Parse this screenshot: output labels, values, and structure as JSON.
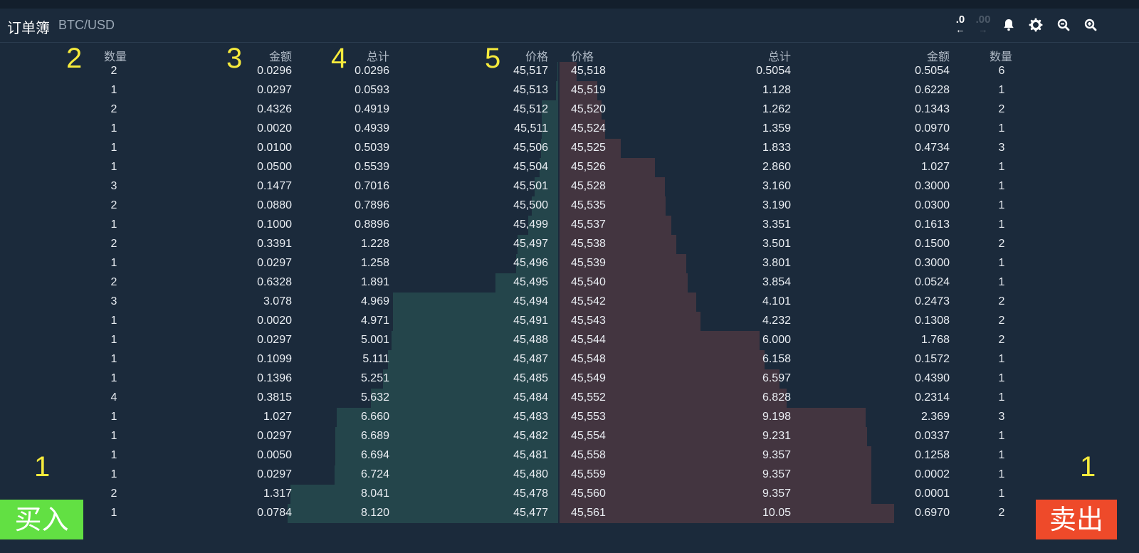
{
  "header": {
    "title": "订单簿",
    "pair": "BTC/USD",
    "decimals_less": ".0",
    "decimals_more": ".00",
    "arrow_left": "←",
    "arrow_right": "→",
    "icons": [
      "bell-icon",
      "gear-icon",
      "zoom-out-icon",
      "zoom-in-icon"
    ]
  },
  "columns": {
    "bid_count": "数量",
    "bid_amount": "金额",
    "bid_total": "总计",
    "bid_price": "价格",
    "ask_price": "价格",
    "ask_total": "总计",
    "ask_amount": "金额",
    "ask_count": "数量"
  },
  "markers": {
    "count_left": "2",
    "amount": "3",
    "total": "4",
    "price": "5",
    "buy_side": "1",
    "sell_side": "1"
  },
  "colors": {
    "background": "#1b2a3b",
    "bid_depth": "#24454b",
    "ask_depth": "#433540",
    "buy_button": "#62e043",
    "sell_button": "#ee4a2a",
    "marker": "#f6ea3c"
  },
  "rows": [
    {
      "bc": "2",
      "ba": "0.0296",
      "bt": "0.0296",
      "bp": "45,517",
      "ap": "45,518",
      "at": "0.5054",
      "aa": "0.5054",
      "ac": "6"
    },
    {
      "bc": "1",
      "ba": "0.0297",
      "bt": "0.0593",
      "bp": "45,513",
      "ap": "45,519",
      "at": "1.128",
      "aa": "0.6228",
      "ac": "1"
    },
    {
      "bc": "2",
      "ba": "0.4326",
      "bt": "0.4919",
      "bp": "45,512",
      "ap": "45,520",
      "at": "1.262",
      "aa": "0.1343",
      "ac": "2"
    },
    {
      "bc": "1",
      "ba": "0.0020",
      "bt": "0.4939",
      "bp": "45,511",
      "ap": "45,524",
      "at": "1.359",
      "aa": "0.0970",
      "ac": "1"
    },
    {
      "bc": "1",
      "ba": "0.0100",
      "bt": "0.5039",
      "bp": "45,506",
      "ap": "45,525",
      "at": "1.833",
      "aa": "0.4734",
      "ac": "3"
    },
    {
      "bc": "1",
      "ba": "0.0500",
      "bt": "0.5539",
      "bp": "45,504",
      "ap": "45,526",
      "at": "2.860",
      "aa": "1.027",
      "ac": "1"
    },
    {
      "bc": "3",
      "ba": "0.1477",
      "bt": "0.7016",
      "bp": "45,501",
      "ap": "45,528",
      "at": "3.160",
      "aa": "0.3000",
      "ac": "1"
    },
    {
      "bc": "2",
      "ba": "0.0880",
      "bt": "0.7896",
      "bp": "45,500",
      "ap": "45,535",
      "at": "3.190",
      "aa": "0.0300",
      "ac": "1"
    },
    {
      "bc": "1",
      "ba": "0.1000",
      "bt": "0.8896",
      "bp": "45,499",
      "ap": "45,537",
      "at": "3.351",
      "aa": "0.1613",
      "ac": "1"
    },
    {
      "bc": "2",
      "ba": "0.3391",
      "bt": "1.228",
      "bp": "45,497",
      "ap": "45,538",
      "at": "3.501",
      "aa": "0.1500",
      "ac": "2"
    },
    {
      "bc": "1",
      "ba": "0.0297",
      "bt": "1.258",
      "bp": "45,496",
      "ap": "45,539",
      "at": "3.801",
      "aa": "0.3000",
      "ac": "1"
    },
    {
      "bc": "2",
      "ba": "0.6328",
      "bt": "1.891",
      "bp": "45,495",
      "ap": "45,540",
      "at": "3.854",
      "aa": "0.0524",
      "ac": "1"
    },
    {
      "bc": "3",
      "ba": "3.078",
      "bt": "4.969",
      "bp": "45,494",
      "ap": "45,542",
      "at": "4.101",
      "aa": "0.2473",
      "ac": "2"
    },
    {
      "bc": "1",
      "ba": "0.0020",
      "bt": "4.971",
      "bp": "45,491",
      "ap": "45,543",
      "at": "4.232",
      "aa": "0.1308",
      "ac": "2"
    },
    {
      "bc": "1",
      "ba": "0.0297",
      "bt": "5.001",
      "bp": "45,488",
      "ap": "45,544",
      "at": "6.000",
      "aa": "1.768",
      "ac": "2"
    },
    {
      "bc": "1",
      "ba": "0.1099",
      "bt": "5.111",
      "bp": "45,487",
      "ap": "45,548",
      "at": "6.158",
      "aa": "0.1572",
      "ac": "1"
    },
    {
      "bc": "1",
      "ba": "0.1396",
      "bt": "5.251",
      "bp": "45,485",
      "ap": "45,549",
      "at": "6.597",
      "aa": "0.4390",
      "ac": "1"
    },
    {
      "bc": "4",
      "ba": "0.3815",
      "bt": "5.632",
      "bp": "45,484",
      "ap": "45,552",
      "at": "6.828",
      "aa": "0.2314",
      "ac": "1"
    },
    {
      "bc": "1",
      "ba": "1.027",
      "bt": "6.660",
      "bp": "45,483",
      "ap": "45,553",
      "at": "9.198",
      "aa": "2.369",
      "ac": "3"
    },
    {
      "bc": "1",
      "ba": "0.0297",
      "bt": "6.689",
      "bp": "45,482",
      "ap": "45,554",
      "at": "9.231",
      "aa": "0.0337",
      "ac": "1"
    },
    {
      "bc": "1",
      "ba": "0.0050",
      "bt": "6.694",
      "bp": "45,481",
      "ap": "45,558",
      "at": "9.357",
      "aa": "0.1258",
      "ac": "1"
    },
    {
      "bc": "1",
      "ba": "0.0297",
      "bt": "6.724",
      "bp": "45,480",
      "ap": "45,559",
      "at": "9.357",
      "aa": "0.0002",
      "ac": "1"
    },
    {
      "bc": "2",
      "ba": "1.317",
      "bt": "8.041",
      "bp": "45,478",
      "ap": "45,560",
      "at": "9.357",
      "aa": "0.0001",
      "ac": "1"
    },
    {
      "bc": "1",
      "ba": "0.0784",
      "bt": "8.120",
      "bp": "45,477",
      "ap": "45,561",
      "at": "10.05",
      "aa": "0.6970",
      "ac": "2"
    }
  ],
  "buttons": {
    "buy": "买入",
    "sell": "卖出"
  }
}
